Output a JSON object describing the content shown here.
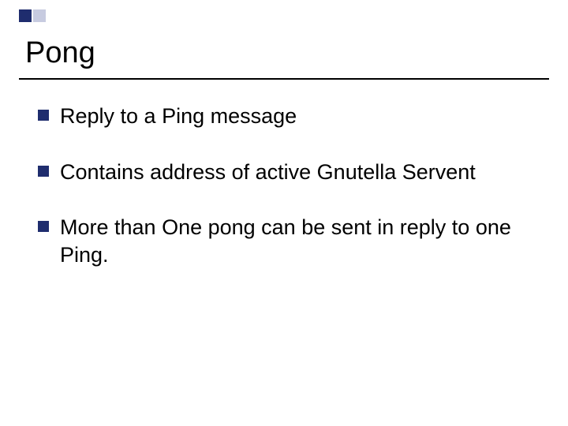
{
  "title": "Pong",
  "bullets": [
    "Reply to a Ping message",
    "Contains address of active Gnutella Servent",
    "More than One pong can be sent in reply to one Ping."
  ]
}
